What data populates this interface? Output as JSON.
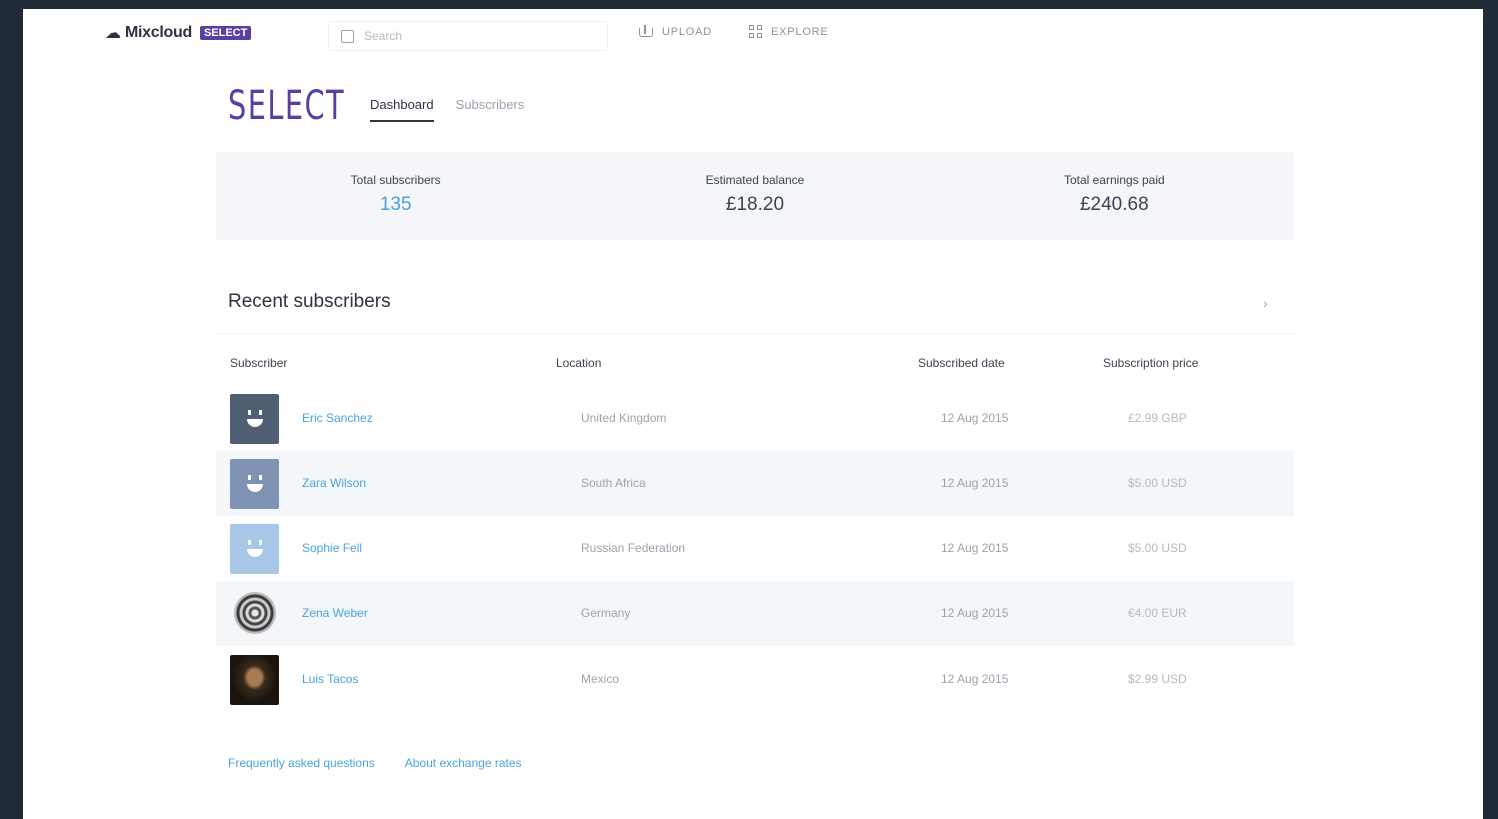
{
  "header": {
    "logo_text": "Mixcloud",
    "logo_badge": "SELECT",
    "search_placeholder": "Search",
    "nav_upload": "UPLOAD",
    "nav_explore": "EXPLORE"
  },
  "select": {
    "title": "SELECT",
    "tabs": [
      "Dashboard",
      "Subscribers"
    ]
  },
  "stats": [
    {
      "label": "Total subscribers",
      "value": "135"
    },
    {
      "label": "Estimated balance",
      "value": "£18.20"
    },
    {
      "label": "Total earnings paid",
      "value": "£240.68"
    }
  ],
  "recent": {
    "title": "Recent subscribers",
    "arrow": "›",
    "columns": [
      "Subscriber",
      "Location",
      "Subscribed date",
      "Subscription price"
    ],
    "rows": [
      {
        "name": "Eric Sanchez",
        "location": "United Kingdom",
        "date": "12 Aug 2015",
        "price": "£2.99 GBP",
        "avatar_color": "#4f5e73"
      },
      {
        "name": "Zara Wilson",
        "location": "South Africa",
        "date": "12 Aug 2015",
        "price": "$5.00 USD",
        "avatar_color": "#7e93b4"
      },
      {
        "name": "Sophie Fell",
        "location": "Russian Federation",
        "date": "12 Aug 2015",
        "price": "$5.00 USD",
        "avatar_color": "#a8c6e6"
      },
      {
        "name": "Zena Weber",
        "location": "Germany",
        "date": "12 Aug 2015",
        "price": "€4.00 EUR",
        "avatar_color": "#555555"
      },
      {
        "name": "Luis Tacos",
        "location": "Mexico",
        "date": "12 Aug 2015",
        "price": "$2.99 USD",
        "avatar_color": "#2a1e16"
      }
    ]
  },
  "footer": {
    "faq": "Frequently asked questions",
    "rates": "About exchange rates"
  }
}
